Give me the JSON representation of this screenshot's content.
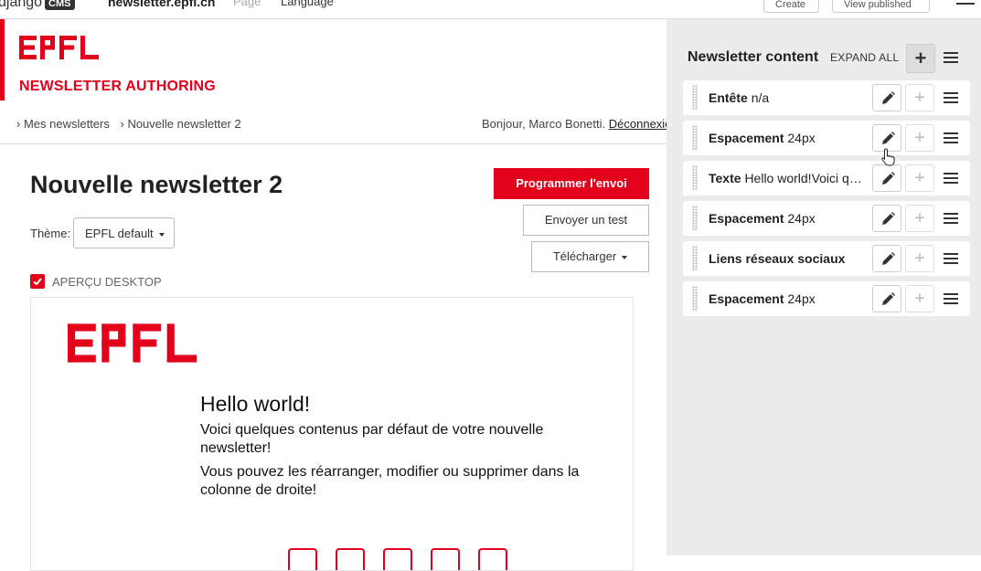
{
  "toolbar": {
    "logo_text": "django",
    "logo_badge": "CMS",
    "site_name": "newsletter.epfl.ch",
    "page_menu": "Page",
    "language_menu": "Language",
    "create_button": "Create",
    "view_published_button": "View published"
  },
  "header": {
    "logo_text": "EPFL",
    "app_title": "NEWSLETTER AUTHORING"
  },
  "breadcrumb": {
    "items": [
      "› Mes newsletters",
      "› Nouvelle newsletter 2"
    ]
  },
  "user": {
    "greeting": "Bonjour, Marco Bonetti.",
    "logout_label": "Déconnexion"
  },
  "main": {
    "page_title": "Nouvelle newsletter 2",
    "schedule_button": "Programmer l'envoi",
    "test_button": "Envoyer un test",
    "download_button": "Télécharger",
    "theme_label": "Thème:",
    "theme_value": "EPFL default",
    "preview_label": "APERÇU DESKTOP",
    "preview_checked": true
  },
  "preview": {
    "logo_text": "EPFL",
    "title": "Hello world!",
    "paragraph1": "Voici quelques contenus par défaut de votre nouvelle newsletter!",
    "paragraph2": "Vous pouvez les réarranger, modifier ou supprimer dans la colonne de droite!"
  },
  "sidebar": {
    "title": "Newsletter content",
    "expand_all": "EXPAND ALL",
    "plugins": [
      {
        "name": "Entête",
        "detail": "n/a"
      },
      {
        "name": "Espacement",
        "detail": "24px"
      },
      {
        "name": "Texte",
        "detail": "Hello world!Voici quelques contenus par défaut"
      },
      {
        "name": "Espacement",
        "detail": "24px"
      },
      {
        "name": "Liens réseaux sociaux",
        "detail": ""
      },
      {
        "name": "Espacement",
        "detail": "24px"
      }
    ]
  },
  "colors": {
    "brand_red": "#e2001a",
    "sidebar_bg": "#ececec"
  }
}
